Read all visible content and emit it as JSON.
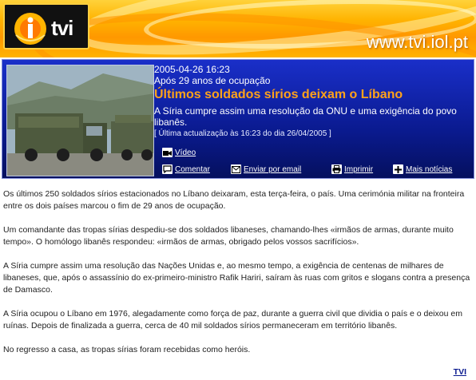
{
  "header": {
    "logo_text": "tvi",
    "site_url": "www.tvi.iol.pt"
  },
  "article": {
    "date": "2005-04-26 16:23",
    "subtitle": "Após 29 anos de ocupação",
    "headline": "Últimos soldados sírios deixam o Líbano",
    "lead": "A Síria cumpre assim uma resolução da ONU e uma exigência do povo libanês.",
    "updated": "[ Última actualização às 16:23 do dia 26/04/2005 ]",
    "paragraphs": [
      "Os últimos 250 soldados sírios estacionados no Líbano deixaram, esta terça-feira, o país. Uma cerimónia militar na fronteira entre os dois países marcou o fim de 29 anos de ocupação.",
      "Um comandante das tropas sírias despediu-se dos soldados libaneses, chamando-lhes «irmãos de armas, durante muito tempo». O homólogo libanês respondeu: «irmãos de armas, obrigado pelos vossos sacrifícios».",
      "A Síria cumpre assim uma resolução das Nações Unidas e, ao mesmo tempo, a exigência de centenas de milhares de libaneses, que, após o assassínio do ex-primeiro-ministro Rafik Hariri, saíram às ruas com gritos e slogans contra a presença de Damasco.",
      "A Síria ocupou o Líbano em 1976, alegadamente como força de paz, durante a guerra civil que dividia o país e o deixou em ruínas. Depois de finalizada a guerra, cerca de 40 mil soldados sírios permaneceram em território libanês.",
      "No regresso a casa, as tropas sírias foram recebidas como heróis."
    ],
    "source": "TVI"
  },
  "actions": {
    "video": "Vídeo",
    "comment": "Comentar",
    "email": "Enviar por email",
    "print": "Imprimir",
    "more": "Mais notícias"
  }
}
